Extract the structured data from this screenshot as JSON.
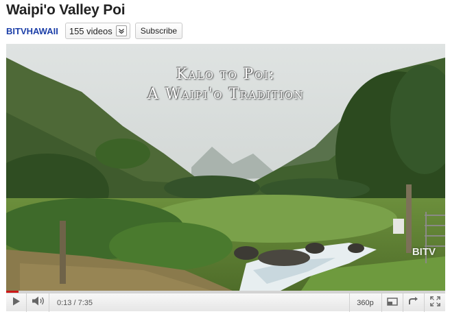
{
  "video_title": "Waipi'o Valley Poi",
  "channel": {
    "name": "BITVHAWAII",
    "videos_count_label": "155 videos",
    "subscribe_label": "Subscribe"
  },
  "video_overlay": {
    "title_line1": "Kalo to Poi:",
    "title_line2": "A Waipi'o Tradition",
    "watermark": "BITV"
  },
  "player": {
    "current_time": "0:13",
    "duration": "7:35",
    "time_display": "0:13 / 7:35",
    "quality": "360p",
    "progress_fraction": 0.0286,
    "accent_color": "#cc1818"
  },
  "icons": {
    "play": "play-icon",
    "volume": "volume-icon",
    "videos_dropdown": "chevron-down-icon",
    "small_player": "small-player-icon",
    "popout": "popout-icon",
    "fullscreen": "fullscreen-icon"
  }
}
